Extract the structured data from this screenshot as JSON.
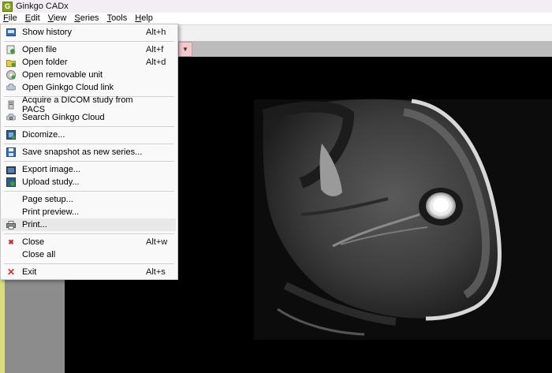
{
  "window": {
    "title": "Ginkgo CADx",
    "icon": "ginkgo-app-icon",
    "icon_letter": "G"
  },
  "menubar": [
    "File",
    "Edit",
    "View",
    "Series",
    "Tools",
    "Help"
  ],
  "file_menu": {
    "items": [
      {
        "label": "Show history",
        "accel": "Alt+h",
        "icon": "history-icon"
      },
      {
        "label": "Open file",
        "accel": "Alt+f",
        "icon": "open-file-icon"
      },
      {
        "label": "Open folder",
        "accel": "Alt+d",
        "icon": "open-folder-icon"
      },
      {
        "label": "Open removable unit",
        "accel": "",
        "icon": "removable-unit-icon"
      },
      {
        "label": "Open Ginkgo Cloud link",
        "accel": "",
        "icon": "cloud-link-icon"
      },
      {
        "label": "Acquire a DICOM study from PACS",
        "accel": "",
        "icon": "pacs-icon"
      },
      {
        "label": "Search Ginkgo Cloud",
        "accel": "",
        "icon": "cloud-search-icon"
      },
      {
        "label": "Dicomize...",
        "accel": "",
        "icon": "dicomize-icon"
      },
      {
        "label": "Save snapshot as new series...",
        "accel": "",
        "icon": "save-icon"
      },
      {
        "label": "Export image...",
        "accel": "",
        "icon": "export-icon"
      },
      {
        "label": "Upload study...",
        "accel": "",
        "icon": "upload-icon"
      },
      {
        "label": "Page setup...",
        "accel": "",
        "icon": ""
      },
      {
        "label": "Print preview...",
        "accel": "",
        "icon": ""
      },
      {
        "label": "Print...",
        "accel": "",
        "icon": "printer-icon"
      },
      {
        "label": "Close",
        "accel": "Alt+w",
        "icon": "close-icon"
      },
      {
        "label": "Close all",
        "accel": "",
        "icon": ""
      },
      {
        "label": "Exit",
        "accel": "Alt+s",
        "icon": "exit-icon"
      }
    ]
  },
  "toolbar": {
    "tab_dropdown_icon": "chevron-down-icon"
  },
  "colors": {
    "menu_bg": "#f9f9f9",
    "viewer_bg": "#000000",
    "side_accent": "#d9de7a",
    "tab_pink": "#f4c9cc"
  }
}
